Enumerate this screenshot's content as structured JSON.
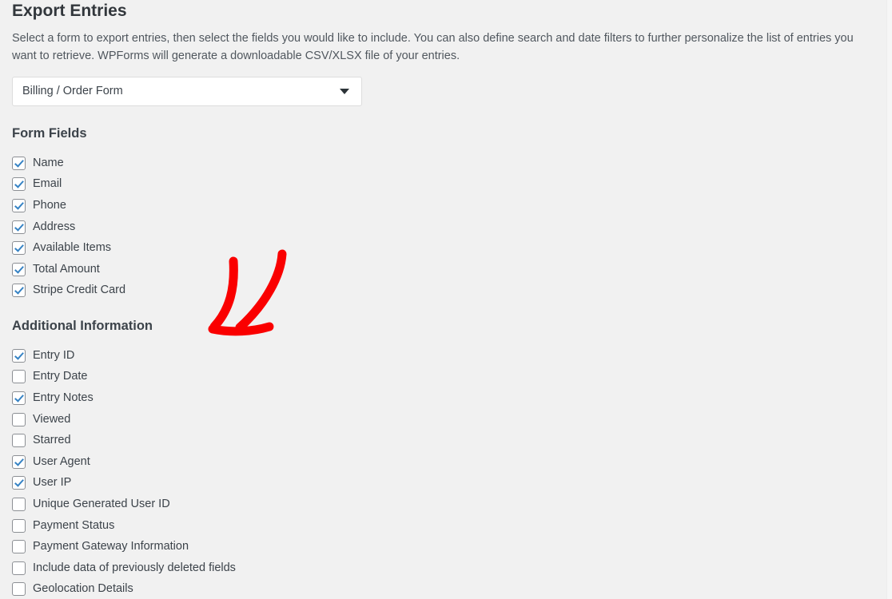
{
  "page": {
    "title": "Export Entries",
    "description": "Select a form to export entries, then select the fields you would like to include. You can also define search and date filters to further personalize the list of entries you want to retrieve. WPForms will generate a downloadable CSV/XLSX file of your entries.",
    "background_color": "#f1f1f1",
    "text_color": "#3c434a"
  },
  "form_selector": {
    "selected_value": "Billing / Order Form",
    "caret_icon": "chevron-down-icon",
    "accent_color": "#2c3338"
  },
  "form_fields": {
    "heading": "Form Fields",
    "items": [
      {
        "label": "Name",
        "checked": true
      },
      {
        "label": "Email",
        "checked": true
      },
      {
        "label": "Phone",
        "checked": true
      },
      {
        "label": "Address",
        "checked": true
      },
      {
        "label": "Available Items",
        "checked": true
      },
      {
        "label": "Total Amount",
        "checked": true
      },
      {
        "label": "Stripe Credit Card",
        "checked": true
      }
    ]
  },
  "additional_information": {
    "heading": "Additional Information",
    "items": [
      {
        "label": "Entry ID",
        "checked": true
      },
      {
        "label": "Entry Date",
        "checked": false
      },
      {
        "label": "Entry Notes",
        "checked": true
      },
      {
        "label": "Viewed",
        "checked": false
      },
      {
        "label": "Starred",
        "checked": false
      },
      {
        "label": "User Agent",
        "checked": true
      },
      {
        "label": "User IP",
        "checked": true
      },
      {
        "label": "Unique Generated User ID",
        "checked": false
      },
      {
        "label": "Payment Status",
        "checked": false
      },
      {
        "label": "Payment Gateway Information",
        "checked": false
      },
      {
        "label": "Include data of previously deleted fields",
        "checked": false
      },
      {
        "label": "Geolocation Details",
        "checked": false
      }
    ]
  },
  "annotation": {
    "type": "hand-drawn-arrow",
    "direction": "down-left",
    "color": "#fa0000"
  },
  "checkbox_colors": {
    "checkmark": "#3582c4",
    "border": "#8c8f94",
    "fill": "#ffffff"
  }
}
